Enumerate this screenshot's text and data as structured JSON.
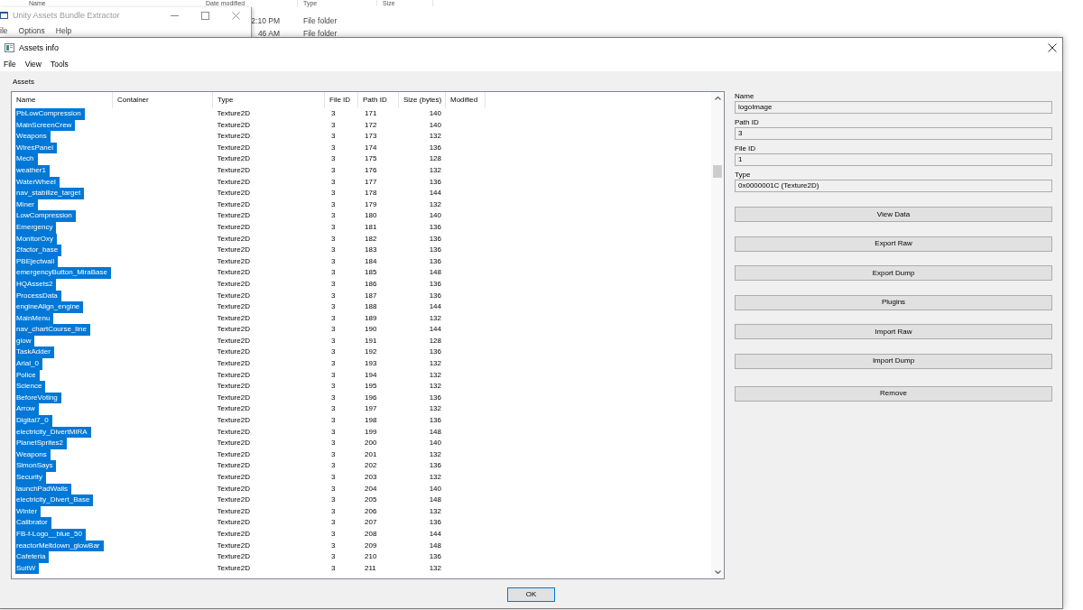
{
  "explorer": {
    "columns": [
      "Name",
      "Date modified",
      "Type",
      "Size"
    ],
    "rows": [
      {
        "date_modified": "2:10 PM",
        "type": "File folder"
      },
      {
        "date_modified": "46 AM",
        "type": "File folder"
      }
    ]
  },
  "extractor_window": {
    "title": "Unity Assets Bundle Extractor",
    "menu": [
      "ile",
      "Options",
      "Help"
    ]
  },
  "assets_info": {
    "title": "Assets info",
    "menu": [
      "File",
      "View",
      "Tools"
    ],
    "group_label": "Assets",
    "table": {
      "columns": [
        "Name",
        "Container",
        "Type",
        "File ID",
        "Path ID",
        "Size (bytes)",
        "Modified"
      ],
      "rows": [
        {
          "name": "PbLowCompression",
          "type": "Texture2D",
          "file_id": "3",
          "path_id": "171",
          "size": "140",
          "selected": true
        },
        {
          "name": "MainScreenCrew",
          "type": "Texture2D",
          "file_id": "3",
          "path_id": "172",
          "size": "140",
          "selected": true
        },
        {
          "name": "Weapons",
          "type": "Texture2D",
          "file_id": "3",
          "path_id": "173",
          "size": "132",
          "selected": true
        },
        {
          "name": "WiresPanel",
          "type": "Texture2D",
          "file_id": "3",
          "path_id": "174",
          "size": "136",
          "selected": true
        },
        {
          "name": "Mech",
          "type": "Texture2D",
          "file_id": "3",
          "path_id": "175",
          "size": "128",
          "selected": true
        },
        {
          "name": "weather1",
          "type": "Texture2D",
          "file_id": "3",
          "path_id": "176",
          "size": "132",
          "selected": true
        },
        {
          "name": "WaterWheel",
          "type": "Texture2D",
          "file_id": "3",
          "path_id": "177",
          "size": "136",
          "selected": true
        },
        {
          "name": "nav_stabilize_target",
          "type": "Texture2D",
          "file_id": "3",
          "path_id": "178",
          "size": "144",
          "selected": true
        },
        {
          "name": "Miner",
          "type": "Texture2D",
          "file_id": "3",
          "path_id": "179",
          "size": "132",
          "selected": true
        },
        {
          "name": "LowCompression",
          "type": "Texture2D",
          "file_id": "3",
          "path_id": "180",
          "size": "140",
          "selected": true
        },
        {
          "name": "Emergency",
          "type": "Texture2D",
          "file_id": "3",
          "path_id": "181",
          "size": "136",
          "selected": true
        },
        {
          "name": "MonitorOxy",
          "type": "Texture2D",
          "file_id": "3",
          "path_id": "182",
          "size": "136",
          "selected": true
        },
        {
          "name": "2factor_base",
          "type": "Texture2D",
          "file_id": "3",
          "path_id": "183",
          "size": "136",
          "selected": true
        },
        {
          "name": "PBEjectwall",
          "type": "Texture2D",
          "file_id": "3",
          "path_id": "184",
          "size": "136",
          "selected": true
        },
        {
          "name": "emergencyButton_MiraBase",
          "type": "Texture2D",
          "file_id": "3",
          "path_id": "185",
          "size": "148",
          "selected": true
        },
        {
          "name": "HQAssets2",
          "type": "Texture2D",
          "file_id": "3",
          "path_id": "186",
          "size": "136",
          "selected": true
        },
        {
          "name": "ProcessData",
          "type": "Texture2D",
          "file_id": "3",
          "path_id": "187",
          "size": "136",
          "selected": true
        },
        {
          "name": "engineAlign_engine",
          "type": "Texture2D",
          "file_id": "3",
          "path_id": "188",
          "size": "144",
          "selected": true
        },
        {
          "name": "MainMenu",
          "type": "Texture2D",
          "file_id": "3",
          "path_id": "189",
          "size": "132",
          "selected": true
        },
        {
          "name": "nav_chartCourse_line",
          "type": "Texture2D",
          "file_id": "3",
          "path_id": "190",
          "size": "144",
          "selected": true
        },
        {
          "name": "glow",
          "type": "Texture2D",
          "file_id": "3",
          "path_id": "191",
          "size": "128",
          "selected": true
        },
        {
          "name": "TaskAdder",
          "type": "Texture2D",
          "file_id": "3",
          "path_id": "192",
          "size": "136",
          "selected": true
        },
        {
          "name": "Arial_0",
          "type": "Texture2D",
          "file_id": "3",
          "path_id": "193",
          "size": "132",
          "selected": true
        },
        {
          "name": "Police",
          "type": "Texture2D",
          "file_id": "3",
          "path_id": "194",
          "size": "132",
          "selected": true
        },
        {
          "name": "Science",
          "type": "Texture2D",
          "file_id": "3",
          "path_id": "195",
          "size": "132",
          "selected": true
        },
        {
          "name": "BeforeVoting",
          "type": "Texture2D",
          "file_id": "3",
          "path_id": "196",
          "size": "136",
          "selected": true
        },
        {
          "name": "Arrow",
          "type": "Texture2D",
          "file_id": "3",
          "path_id": "197",
          "size": "132",
          "selected": true
        },
        {
          "name": "Digital7_0",
          "type": "Texture2D",
          "file_id": "3",
          "path_id": "198",
          "size": "136",
          "selected": true
        },
        {
          "name": "electricity_DivertMIRA",
          "type": "Texture2D",
          "file_id": "3",
          "path_id": "199",
          "size": "148",
          "selected": true
        },
        {
          "name": "PlanetSprites2",
          "type": "Texture2D",
          "file_id": "3",
          "path_id": "200",
          "size": "140",
          "selected": true
        },
        {
          "name": "Weapons",
          "type": "Texture2D",
          "file_id": "3",
          "path_id": "201",
          "size": "132",
          "selected": true
        },
        {
          "name": "SimonSays",
          "type": "Texture2D",
          "file_id": "3",
          "path_id": "202",
          "size": "136",
          "selected": true
        },
        {
          "name": "Security",
          "type": "Texture2D",
          "file_id": "3",
          "path_id": "203",
          "size": "132",
          "selected": true
        },
        {
          "name": "launchPadWalls",
          "type": "Texture2D",
          "file_id": "3",
          "path_id": "204",
          "size": "140",
          "selected": true
        },
        {
          "name": "electricity_Divert_Base",
          "type": "Texture2D",
          "file_id": "3",
          "path_id": "205",
          "size": "148",
          "selected": true
        },
        {
          "name": "Winter",
          "type": "Texture2D",
          "file_id": "3",
          "path_id": "206",
          "size": "132",
          "selected": true
        },
        {
          "name": "Calibrator",
          "type": "Texture2D",
          "file_id": "3",
          "path_id": "207",
          "size": "136",
          "selected": true
        },
        {
          "name": "FB-f-Logo__blue_50",
          "type": "Texture2D",
          "file_id": "3",
          "path_id": "208",
          "size": "144",
          "selected": true
        },
        {
          "name": "reactorMeltdown_glowBar",
          "type": "Texture2D",
          "file_id": "3",
          "path_id": "209",
          "size": "148",
          "selected": true
        },
        {
          "name": "Cafeteria",
          "type": "Texture2D",
          "file_id": "3",
          "path_id": "210",
          "size": "136",
          "selected": true
        },
        {
          "name": "SuitW",
          "type": "Texture2D",
          "file_id": "3",
          "path_id": "211",
          "size": "132",
          "selected": true
        }
      ]
    },
    "details": {
      "fields": [
        {
          "label": "Name",
          "value": "logoImage"
        },
        {
          "label": "Path ID",
          "value": "3"
        },
        {
          "label": "File ID",
          "value": "1"
        },
        {
          "label": "Type",
          "value": "0x0000001C (Texture2D)"
        }
      ],
      "buttons": [
        "View Data",
        "Export Raw",
        "Export Dump",
        "Plugins",
        "Import Raw",
        "Import Dump",
        "Remove"
      ]
    },
    "ok_button": "OK"
  }
}
